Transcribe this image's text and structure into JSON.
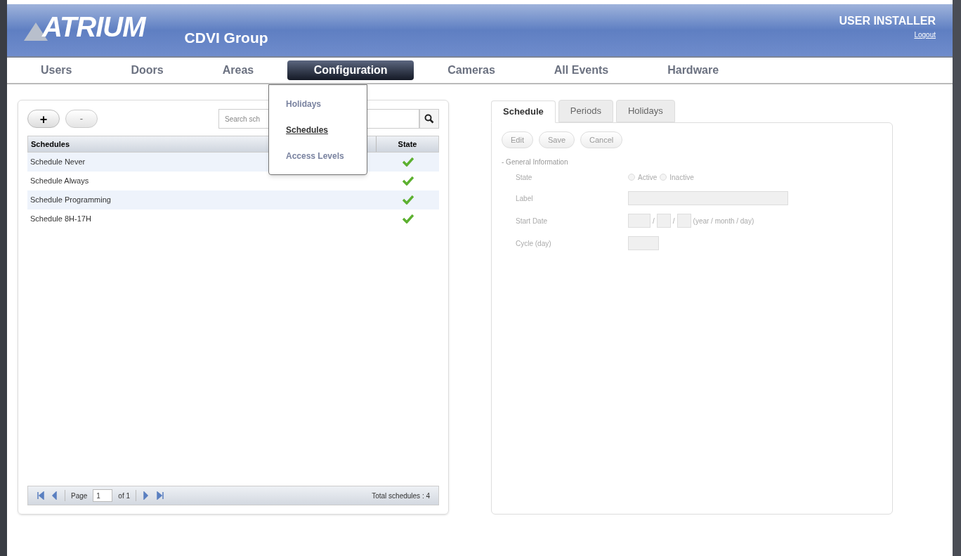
{
  "header": {
    "logo": "ATRIUM",
    "company": "CDVI Group",
    "user": "USER INSTALLER",
    "logout": "Logout"
  },
  "nav": [
    {
      "label": "Users",
      "selected": false
    },
    {
      "label": "Doors",
      "selected": false
    },
    {
      "label": "Areas",
      "selected": false
    },
    {
      "label": "Configuration",
      "selected": true
    },
    {
      "label": "Cameras",
      "selected": false
    },
    {
      "label": "All Events",
      "selected": false
    },
    {
      "label": "Hardware",
      "selected": false
    }
  ],
  "dropdown": [
    {
      "label": "Holidays",
      "selected": false
    },
    {
      "label": "Schedules",
      "selected": true
    },
    {
      "label": "Access Levels",
      "selected": false
    }
  ],
  "list_panel": {
    "add": "+",
    "remove": "-",
    "search": {
      "placeholder": "Search sch"
    },
    "columns": [
      "Schedules",
      "State"
    ],
    "rows": [
      {
        "name": "Schedule Never",
        "active": true
      },
      {
        "name": "Schedule Always",
        "active": true
      },
      {
        "name": "Schedule Programming",
        "active": true
      },
      {
        "name": "Schedule 8H-17H",
        "active": true
      }
    ],
    "pager": {
      "page_label": "Page",
      "page": "1",
      "of": "of 1",
      "total": "Total schedules : 4"
    }
  },
  "detail": {
    "tabs": [
      {
        "label": "Schedule",
        "selected": true
      },
      {
        "label": "Periods",
        "selected": false
      },
      {
        "label": "Holidays",
        "selected": false
      }
    ],
    "buttons": [
      "Edit",
      "Save",
      "Cancel"
    ],
    "section": "- General Information",
    "state_label": "State",
    "radios": [
      {
        "label": "Active",
        "selected": false
      },
      {
        "label": "Inactive",
        "selected": false
      }
    ],
    "label_label": "Label",
    "start_label": "Start Date",
    "date_separators": [
      "/",
      "/"
    ],
    "date_hint": "(year / month / day)",
    "cycle_label": "Cycle (day)"
  }
}
